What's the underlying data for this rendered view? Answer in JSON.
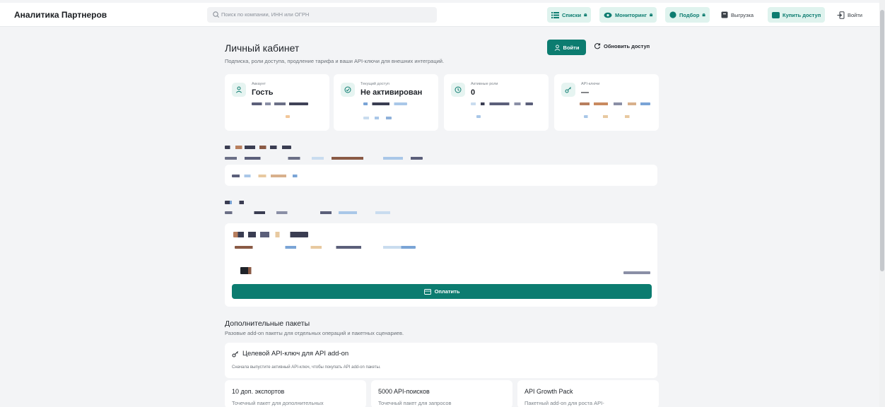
{
  "header": {
    "brand": "Аналитика Партнеров",
    "search_placeholder": "Поиск по компании, ИНН или ОГРН",
    "nav": {
      "lists": "Списки",
      "monitoring": "Мониторинг",
      "selection": "Подбор",
      "export": "Выгрузка",
      "buy_access": "Купить доступ",
      "login": "Войти"
    }
  },
  "page": {
    "title": "Личный кабинет",
    "subtitle": "Подписка, роли доступа, продление тарифа и ваши API-ключи для внешних интеграций.",
    "login_button": "Войти",
    "refresh_button": "Обновить доступ"
  },
  "cards": {
    "account": {
      "label": "Аккаунт",
      "value": "Гость"
    },
    "access": {
      "label": "Текущий доступ",
      "value": "Не активирован"
    },
    "roles": {
      "label": "Активные роли",
      "value": "0"
    },
    "api_keys": {
      "label": "API-ключи",
      "value": "—"
    }
  },
  "payment": {
    "pay_button": "Оплатить"
  },
  "addons": {
    "title": "Дополнительные пакеты",
    "subtitle": "Разовые add-on пакеты для отдельных операций и пакетных сценариев.",
    "api_key_title": "Целевой API-ключ для API add-on",
    "api_key_note": "Сначала выпустите активный API-ключ, чтобы покупать API add-on пакеты.",
    "packages": [
      {
        "title": "10 доп. экспортов",
        "desc": "Точечный пакет для дополнительных"
      },
      {
        "title": "5000 API-поисков",
        "desc": "Точечный пакет для запросов"
      },
      {
        "title": "API Growth Pack",
        "desc": "Пакетный add-on для роста API-"
      }
    ]
  },
  "colors": {
    "accent": "#0c7c70",
    "accent_tint": "#dff3ee"
  }
}
